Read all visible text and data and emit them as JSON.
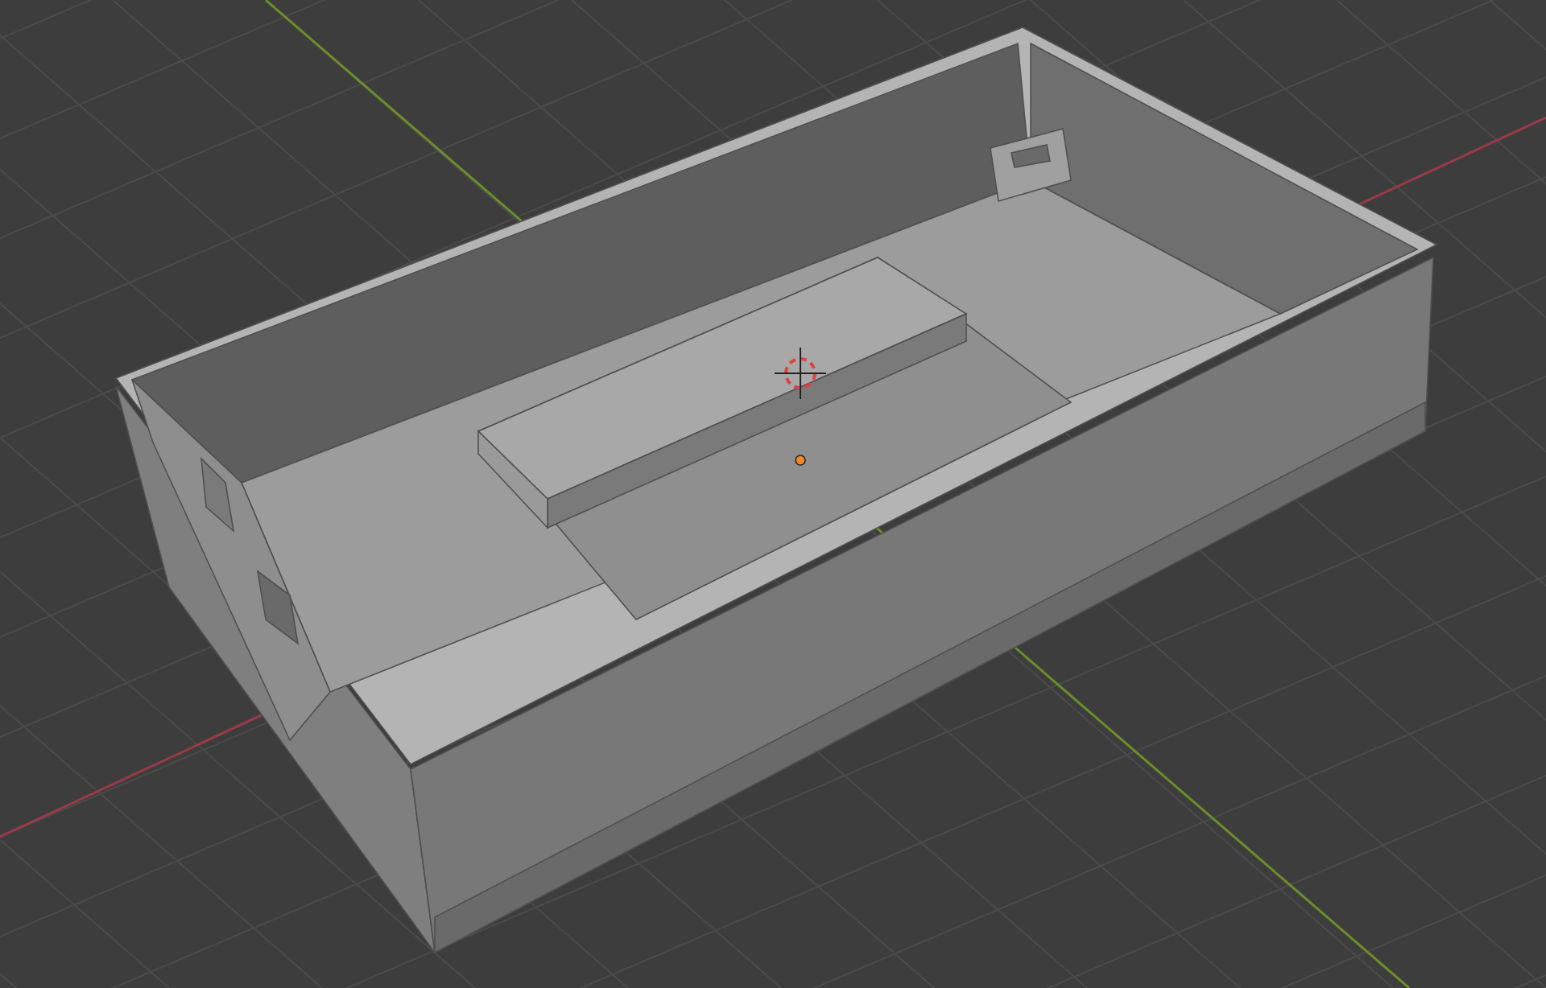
{
  "viewport": {
    "grid": true,
    "axes": true,
    "cursor_3d": true,
    "origin_point": true
  }
}
